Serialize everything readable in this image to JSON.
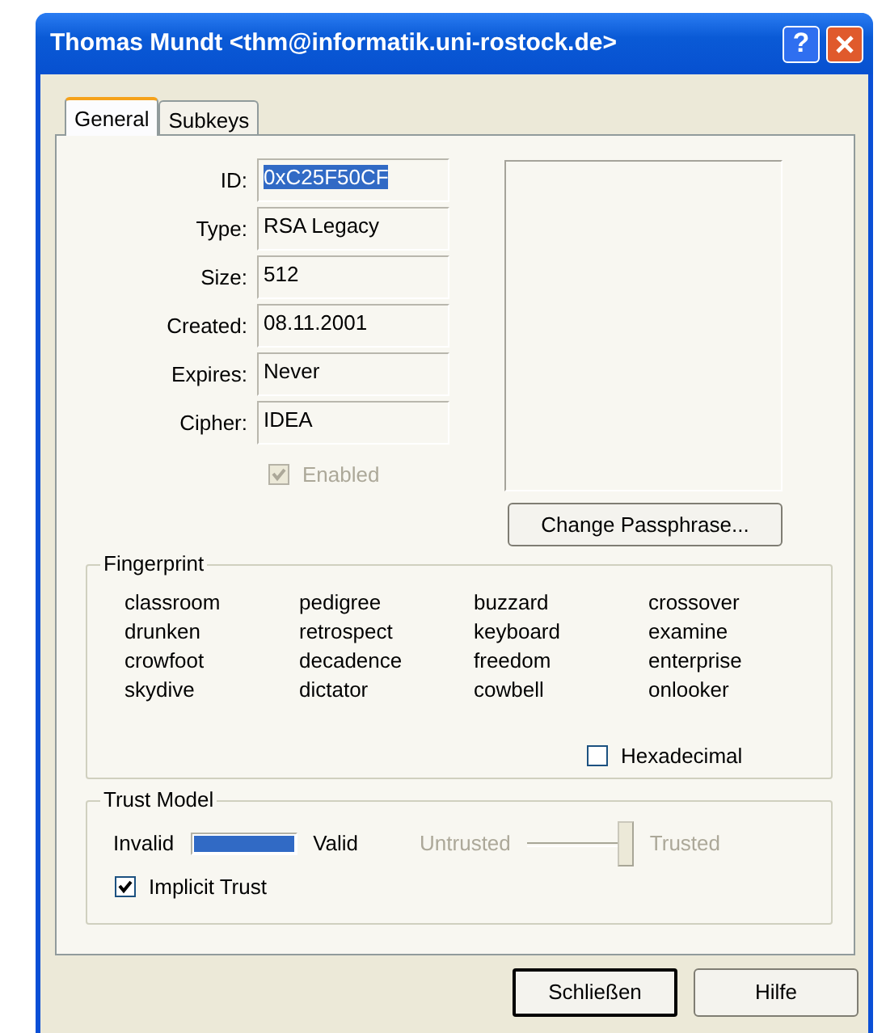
{
  "window": {
    "title": "Thomas Mundt <thm@informatik.uni-rostock.de>"
  },
  "title_buttons": [
    {
      "kind": "help",
      "glyph": "?"
    },
    {
      "kind": "close"
    }
  ],
  "tabs": [
    {
      "label": "General",
      "selected": true
    },
    {
      "label": "Subkeys",
      "selected": false
    }
  ],
  "key_fields": [
    {
      "label": "ID:",
      "value": "0xC25F50CF",
      "highlighted": true
    },
    {
      "label": "Type:",
      "value": "RSA Legacy",
      "highlighted": false
    },
    {
      "label": "Size:",
      "value": "512",
      "highlighted": false
    },
    {
      "label": "Created:",
      "value": "08.11.2001",
      "highlighted": false
    },
    {
      "label": "Expires:",
      "value": "Never",
      "highlighted": false
    },
    {
      "label": "Cipher:",
      "value": "IDEA",
      "highlighted": false
    }
  ],
  "enabled": {
    "label": "Enabled",
    "checked": true,
    "disabled": true
  },
  "change_passphrase": {
    "label": "Change Passphrase..."
  },
  "fingerprint": {
    "title": "Fingerprint",
    "words": [
      [
        "classroom",
        "pedigree",
        "buzzard",
        "crossover"
      ],
      [
        "drunken",
        "retrospect",
        "keyboard",
        "examine"
      ],
      [
        "crowfoot",
        "decadence",
        "freedom",
        "enterprise"
      ],
      [
        "skydive",
        "dictator",
        "cowbell",
        "onlooker"
      ]
    ],
    "hexadecimal": {
      "label": "Hexadecimal",
      "checked": false,
      "disabled": false
    }
  },
  "trust_model": {
    "title": "Trust Model",
    "validity": {
      "left": "Invalid",
      "right": "Valid",
      "level": 1
    },
    "trust": {
      "left": "Untrusted",
      "right": "Trusted",
      "level": 1,
      "disabled": true
    },
    "implicit_trust": {
      "label": "Implicit Trust",
      "checked": true,
      "disabled": false
    }
  },
  "buttons": [
    {
      "label": "Schließen",
      "default": true
    },
    {
      "label": "Hilfe",
      "default": false
    }
  ]
}
